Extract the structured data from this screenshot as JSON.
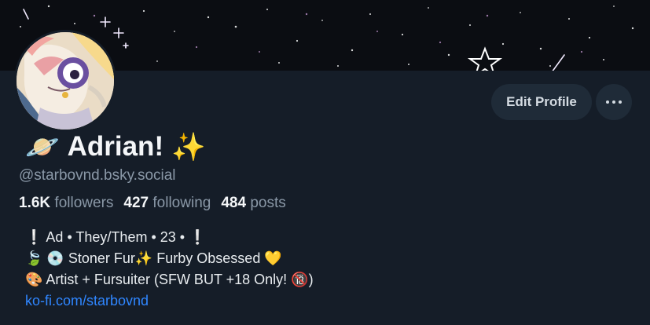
{
  "profile": {
    "name_prefix_emoji": "🪐",
    "display_name": "Adrian!",
    "name_suffix_emoji": "✨",
    "handle": "@starbovnd.bsky.social",
    "avatar_icon": "avatar-illustration"
  },
  "actions": {
    "edit_label": "Edit Profile",
    "more_icon": "ellipsis-icon"
  },
  "stats": {
    "followers_count": "1.6K",
    "followers_label": "followers",
    "following_count": "427",
    "following_label": "following",
    "posts_count": "484",
    "posts_label": "posts"
  },
  "bio": {
    "line1": "❕ Ad • They/Them • 23  • ❕",
    "line2": "🍃 💿 Stoner Fur✨ Furby Obsessed 💛",
    "line3": "🎨 Artist + Fursuiter (SFW BUT +18 Only! 🔞)",
    "link": "ko-fi.com/starbovnd"
  },
  "colors": {
    "background": "#151d28",
    "banner": "#0b0d12",
    "button": "#1f2b38",
    "link": "#2f86ff",
    "muted_text": "#8a98a7"
  }
}
